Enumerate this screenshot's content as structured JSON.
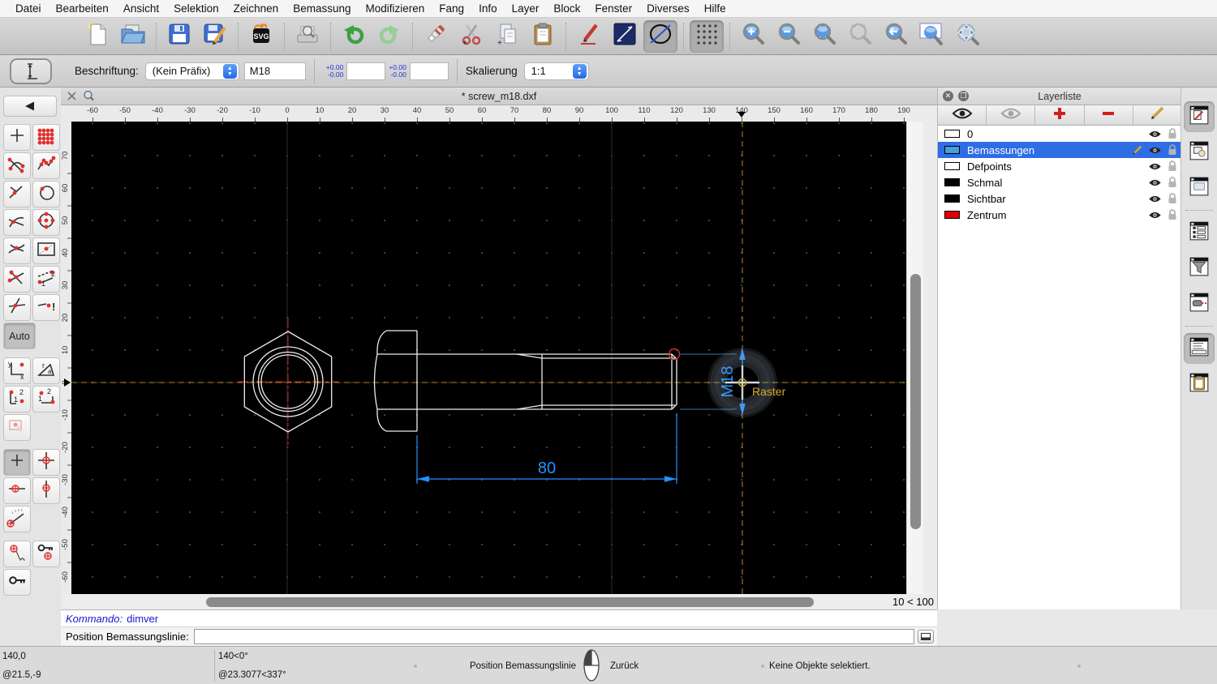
{
  "menu": {
    "items": [
      "Datei",
      "Bearbeiten",
      "Ansicht",
      "Selektion",
      "Zeichnen",
      "Bemassung",
      "Modifizieren",
      "Fang",
      "Info",
      "Layer",
      "Block",
      "Fenster",
      "Diverses",
      "Hilfe"
    ]
  },
  "toolbar": {
    "groups": [
      [
        {
          "name": "new-document"
        },
        {
          "name": "open-file"
        }
      ],
      [
        {
          "name": "save"
        },
        {
          "name": "save-as"
        }
      ],
      [
        {
          "name": "svg-export"
        }
      ],
      [
        {
          "name": "print-preview"
        }
      ],
      [
        {
          "name": "undo"
        },
        {
          "name": "redo"
        }
      ],
      [
        {
          "name": "delete"
        },
        {
          "name": "cut"
        },
        {
          "name": "copy"
        },
        {
          "name": "paste"
        }
      ],
      [
        {
          "name": "pen-edit"
        },
        {
          "name": "line-attributes"
        },
        {
          "name": "circle-attributes",
          "pressed": true
        }
      ],
      [
        {
          "name": "grid-toggle",
          "pressed": true
        }
      ],
      [
        {
          "name": "zoom-in"
        },
        {
          "name": "zoom-out"
        },
        {
          "name": "zoom-auto"
        },
        {
          "name": "zoom-selection",
          "disabled": true
        },
        {
          "name": "zoom-previous"
        },
        {
          "name": "zoom-window"
        },
        {
          "name": "zoom-pan"
        }
      ]
    ]
  },
  "options": {
    "current_tool": "dimension-vertical",
    "label": "Beschriftung:",
    "prefix_value": "(Kein Präfix)",
    "text_value": "M18",
    "tolerance_upper": "+0.00",
    "tolerance_lower": "-0.00",
    "tolerance1_value": "",
    "tolerance2_value": "",
    "scale_label": "Skalierung",
    "scale_value": "1:1"
  },
  "tab": {
    "title": "* screw_m18.dxf"
  },
  "rulers": {
    "h_ticks": [
      -60,
      -50,
      -40,
      -30,
      -20,
      -10,
      0,
      10,
      20,
      30,
      40,
      50,
      60,
      70,
      80,
      90,
      100,
      110,
      120,
      130,
      140,
      150,
      160,
      170,
      180,
      190
    ],
    "v_ticks": [
      70,
      60,
      50,
      40,
      30,
      20,
      10,
      0,
      -10,
      -20,
      -30,
      -40,
      -50,
      -60
    ],
    "h_marker": 140,
    "v_marker": 0
  },
  "drawing": {
    "dim_length": "80",
    "dim_thread": "M18",
    "snap_label": "Raster",
    "grid_info": "10 < 100",
    "dim_color": "#2391ff",
    "snap_color": "#d9a62a"
  },
  "layers": {
    "title": "Layerliste",
    "toolbar": [
      "show-all-layers",
      "hide-all-layers",
      "add-layer",
      "remove-layer",
      "edit-layer"
    ],
    "items": [
      {
        "name": "0",
        "color": "#ffffff",
        "selected": false
      },
      {
        "name": "Bemassungen",
        "color": "#42a0dc",
        "selected": true
      },
      {
        "name": "Defpoints",
        "color": "#ffffff",
        "selected": false
      },
      {
        "name": "Schmal",
        "color": "#000000",
        "selected": false
      },
      {
        "name": "Sichtbar",
        "color": "#000000",
        "selected": false
      },
      {
        "name": "Zentrum",
        "color": "#e00000",
        "selected": false
      }
    ]
  },
  "dock": {
    "buttons": [
      {
        "name": "property-editor",
        "pressed": true
      },
      {
        "name": "block-list",
        "pressed": false
      },
      {
        "name": "library-browser",
        "pressed": false
      },
      {
        "name": "layer-list",
        "pressed": false,
        "sep_before": true
      },
      {
        "name": "selection-filter",
        "pressed": false
      },
      {
        "name": "command-trigger",
        "pressed": false
      },
      {
        "name": "command-line",
        "pressed": true,
        "sep_before": true
      },
      {
        "name": "clipboard-panel",
        "pressed": false
      }
    ]
  },
  "command": {
    "prompt": "Kommando:",
    "history": "dimver",
    "input_label": "Position Bemassungslinie:",
    "input_value": ""
  },
  "status": {
    "abs_coord": "140,0",
    "rel_coord": "@21.5,-9",
    "polar_coord": "140<0°",
    "polar_rel": "@23.3077<337°",
    "left_click_hint": "Position Bemassungslinie",
    "right_click_hint": "Zurück",
    "selection_info": "Keine Objekte selektiert."
  },
  "palette": {
    "buttons": [
      {
        "name": "snap-free"
      },
      {
        "name": "snap-grid"
      },
      {
        "name": "snap-endpoints"
      },
      {
        "name": "snap-on-entity"
      },
      {
        "name": "snap-perpendicular"
      },
      {
        "name": "snap-entity-point"
      },
      {
        "name": "snap-tangent"
      },
      {
        "name": "snap-center"
      },
      {
        "name": "snap-middle"
      },
      {
        "name": "snap-reference"
      },
      {
        "name": "snap-intersection-auto"
      },
      {
        "name": "snap-intersection-manual"
      },
      {
        "name": "snap-cross"
      },
      {
        "name": "snap-exclude"
      },
      {
        "name": "auto",
        "label": "Auto",
        "pressed": true,
        "single": true
      },
      {
        "name": "coord-cartesian"
      },
      {
        "name": "coord-polar"
      },
      {
        "name": "coord-corner-1"
      },
      {
        "name": "coord-corner-2"
      },
      {
        "name": "selection-tool",
        "single": true,
        "disabled": true
      },
      {
        "name": "restrict-off",
        "pressed": true
      },
      {
        "name": "restrict-orthogonal"
      },
      {
        "name": "restrict-horizontal"
      },
      {
        "name": "restrict-vertical"
      },
      {
        "name": "angle-meter",
        "single": true
      },
      {
        "name": "snap-coordinate"
      },
      {
        "name": "set-relative-zero"
      },
      {
        "name": "lock-relative-zero",
        "single": true
      }
    ]
  }
}
